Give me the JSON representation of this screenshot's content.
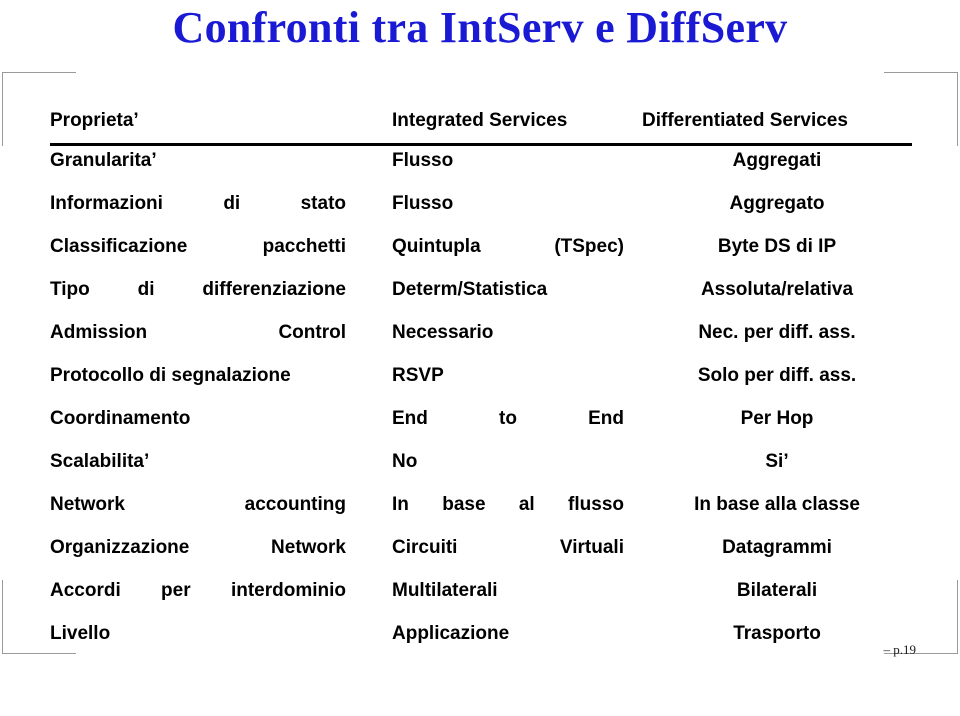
{
  "slide": {
    "title": "Confronti tra IntServ e DiffServ",
    "title_color": "#1a1ad4",
    "page_marker": "– p.19"
  },
  "table": {
    "headers": {
      "property": "Proprieta’",
      "intserv": "Integrated Services",
      "diffserv": "Differentiated Services"
    },
    "rows": [
      {
        "property": "Granularita’",
        "intserv": "Flusso",
        "diffserv": "Aggregati",
        "c1_stretch": false,
        "c2_stretch": false
      },
      {
        "property": "Informazioni di stato",
        "intserv": "Flusso",
        "diffserv": "Aggregato",
        "c1_stretch": true,
        "c2_stretch": false
      },
      {
        "property": "Classificazione pacchetti",
        "intserv": "Quintupla (TSpec)",
        "diffserv": "Byte DS di IP",
        "c1_stretch": true,
        "c2_stretch": true
      },
      {
        "property": "Tipo di differenziazione",
        "intserv": "Determ/Statistica",
        "diffserv": "Assoluta/relativa",
        "c1_stretch": true,
        "c2_stretch": false
      },
      {
        "property": "Admission Control",
        "intserv": "Necessario",
        "diffserv": "Nec. per diff. ass.",
        "c1_stretch": true,
        "c2_stretch": false
      },
      {
        "property": "Protocollo di segnalazione",
        "intserv": "RSVP",
        "diffserv": "Solo per diff. ass.",
        "c1_stretch": false,
        "c2_stretch": false
      },
      {
        "property": "Coordinamento",
        "intserv": "End to End",
        "diffserv": "Per Hop",
        "c1_stretch": false,
        "c2_stretch": true
      },
      {
        "property": "Scalabilita’",
        "intserv": "No",
        "diffserv": "Si’",
        "c1_stretch": false,
        "c2_stretch": false
      },
      {
        "property": "Network accounting",
        "intserv": "In base al flusso",
        "diffserv": "In base alla classe",
        "c1_stretch": true,
        "c2_stretch": true
      },
      {
        "property": "Organizzazione Network",
        "intserv": "Circuiti Virtuali",
        "diffserv": "Datagrammi",
        "c1_stretch": true,
        "c2_stretch": true
      },
      {
        "property": "Accordi per interdominio",
        "intserv": "Multilaterali",
        "diffserv": "Bilaterali",
        "c1_stretch": true,
        "c2_stretch": false
      },
      {
        "property": "Livello",
        "intserv": "Applicazione",
        "diffserv": "Trasporto",
        "c1_stretch": false,
        "c2_stretch": false
      }
    ]
  }
}
